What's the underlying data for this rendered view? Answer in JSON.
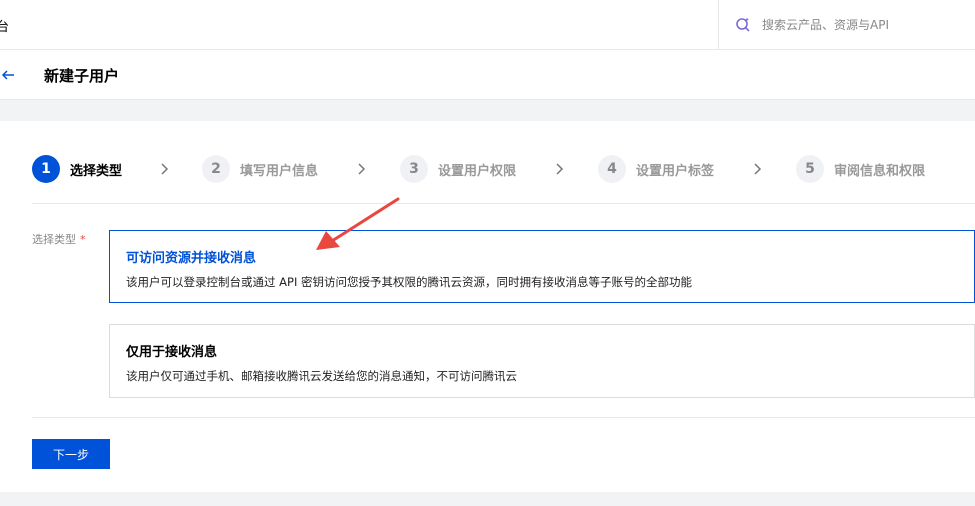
{
  "topbar": {
    "brand_fragment": "台",
    "search_placeholder": "搜索云产品、资源与API"
  },
  "page": {
    "title": "新建子用户"
  },
  "steps": [
    {
      "num": "1",
      "label": "选择类型",
      "active": true
    },
    {
      "num": "2",
      "label": "填写用户信息",
      "active": false
    },
    {
      "num": "3",
      "label": "设置用户权限",
      "active": false
    },
    {
      "num": "4",
      "label": "设置用户标签",
      "active": false
    },
    {
      "num": "5",
      "label": "审阅信息和权限",
      "active": false
    }
  ],
  "form": {
    "type_label": "选择类型",
    "required_mark": "*",
    "options": [
      {
        "title": "可访问资源并接收消息",
        "desc": "该用户可以登录控制台或通过 API 密钥访问您授予其权限的腾讯云资源，同时拥有接收消息等子账号的全部功能",
        "selected": true
      },
      {
        "title": "仅用于接收消息",
        "desc": "该用户仅可通过手机、邮箱接收腾讯云发送给您的消息通知，不可访问腾讯云",
        "selected": false
      }
    ],
    "next_label": "下一步"
  },
  "colors": {
    "primary": "#0052d9",
    "annotation_arrow": "#e8483f"
  },
  "icons": {
    "search": "search-sparkle-icon",
    "back": "arrow-left-icon",
    "step_separator": "chevron-right-icon"
  }
}
